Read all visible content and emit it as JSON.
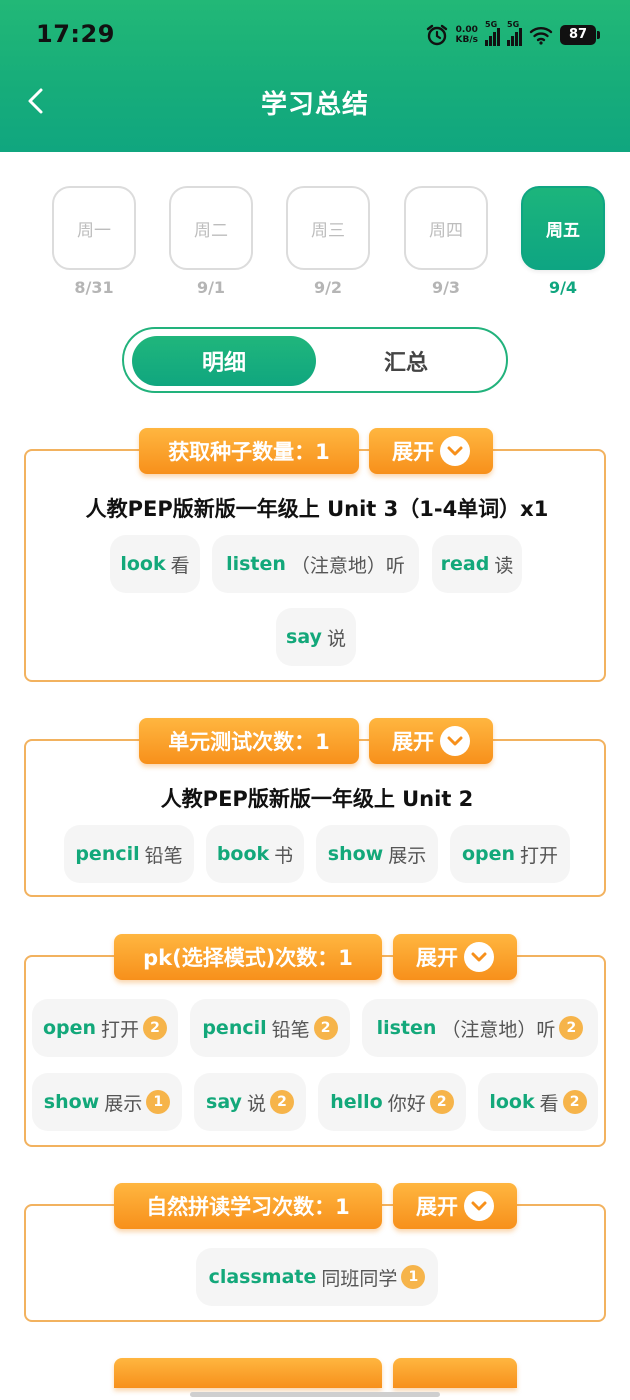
{
  "status": {
    "time": "17:29",
    "speed_value": "0.00",
    "speed_unit": "KB/s",
    "sim1": "5G",
    "sim2": "5G",
    "battery": "87"
  },
  "header": {
    "title": "学习总结"
  },
  "days": [
    {
      "label": "周一",
      "date": "8/31"
    },
    {
      "label": "周二",
      "date": "9/1"
    },
    {
      "label": "周三",
      "date": "9/2"
    },
    {
      "label": "周四",
      "date": "9/3"
    },
    {
      "label": "周五",
      "date": "9/4",
      "selected": true
    }
  ],
  "toggle": {
    "detail": "明细",
    "summary": "汇总"
  },
  "expand_label": "展开",
  "sections": [
    {
      "label": "获取种子数量：1",
      "title": "人教PEP版新版一年级上 Unit 3（1-4单词）x1",
      "words": [
        {
          "en": "look",
          "zh": "看"
        },
        {
          "en": "listen",
          "zh": "（注意地）听"
        },
        {
          "en": "read",
          "zh": "读"
        },
        {
          "en": "say",
          "zh": "说"
        }
      ]
    },
    {
      "label": "单元测试次数：1",
      "title": "人教PEP版新版一年级上 Unit 2",
      "words": [
        {
          "en": "pencil",
          "zh": "铅笔"
        },
        {
          "en": "book",
          "zh": "书"
        },
        {
          "en": "show",
          "zh": "展示"
        },
        {
          "en": "open",
          "zh": "打开"
        }
      ]
    },
    {
      "label": "pk(选择模式)次数：1",
      "words": [
        {
          "en": "open",
          "zh": "打开",
          "count": "2"
        },
        {
          "en": "pencil",
          "zh": "铅笔",
          "count": "2"
        },
        {
          "en": "listen",
          "zh": "（注意地）听",
          "count": "2"
        },
        {
          "en": "show",
          "zh": "展示",
          "count": "1"
        },
        {
          "en": "say",
          "zh": "说",
          "count": "2"
        },
        {
          "en": "hello",
          "zh": "你好",
          "count": "2"
        },
        {
          "en": "look",
          "zh": "看",
          "count": "2"
        }
      ]
    },
    {
      "label": "自然拼读学习次数：1",
      "words": [
        {
          "en": "classmate",
          "zh": "同班同学",
          "count": "1"
        }
      ]
    }
  ],
  "colors": {
    "brand_green": "#10a67f",
    "accent_orange": "#f7901b",
    "card_border": "#f2b25f"
  }
}
